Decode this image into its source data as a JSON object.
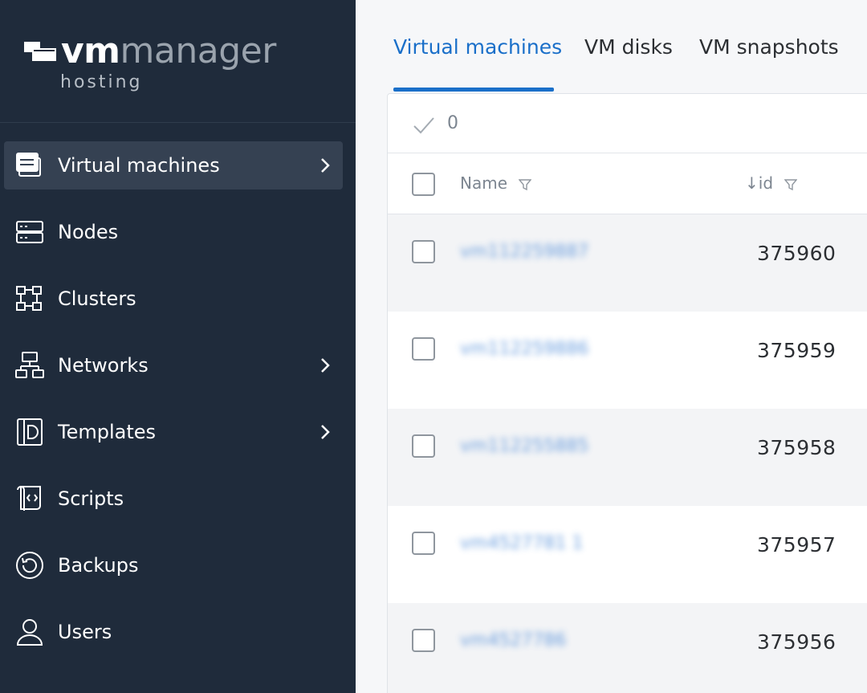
{
  "logo": {
    "word_primary": "vm",
    "word_secondary": "manager",
    "subtitle": "hosting"
  },
  "sidebar": {
    "items": [
      {
        "label": "Virtual machines",
        "icon": "server-stack-icon",
        "active": true,
        "has_chevron": true
      },
      {
        "label": "Nodes",
        "icon": "node-icon",
        "has_chevron": false
      },
      {
        "label": "Clusters",
        "icon": "cluster-icon",
        "has_chevron": false
      },
      {
        "label": "Networks",
        "icon": "network-icon",
        "has_chevron": true
      },
      {
        "label": "Templates",
        "icon": "template-icon",
        "has_chevron": true
      },
      {
        "label": "Scripts",
        "icon": "script-icon",
        "has_chevron": false
      },
      {
        "label": "Backups",
        "icon": "backup-icon",
        "has_chevron": false
      },
      {
        "label": "Users",
        "icon": "user-icon",
        "has_chevron": false
      }
    ]
  },
  "tabs": [
    {
      "label": "Virtual machines",
      "active": true
    },
    {
      "label": "VM disks"
    },
    {
      "label": "VM snapshots"
    }
  ],
  "toolbar": {
    "selected_count": "0"
  },
  "table": {
    "columns": {
      "name": "Name",
      "id": "↓id"
    },
    "rows": [
      {
        "name": "vm112259887",
        "id": "375960"
      },
      {
        "name": "vm112259886",
        "id": "375959"
      },
      {
        "name": "vm112255885",
        "id": "375958"
      },
      {
        "name": "vm4527781 1",
        "id": "375957"
      },
      {
        "name": "vm4527786",
        "id": "375956"
      }
    ]
  },
  "colors": {
    "sidebar_bg": "#1f2b3b",
    "accent": "#1a6fc9",
    "link": "#3b7fd4"
  }
}
